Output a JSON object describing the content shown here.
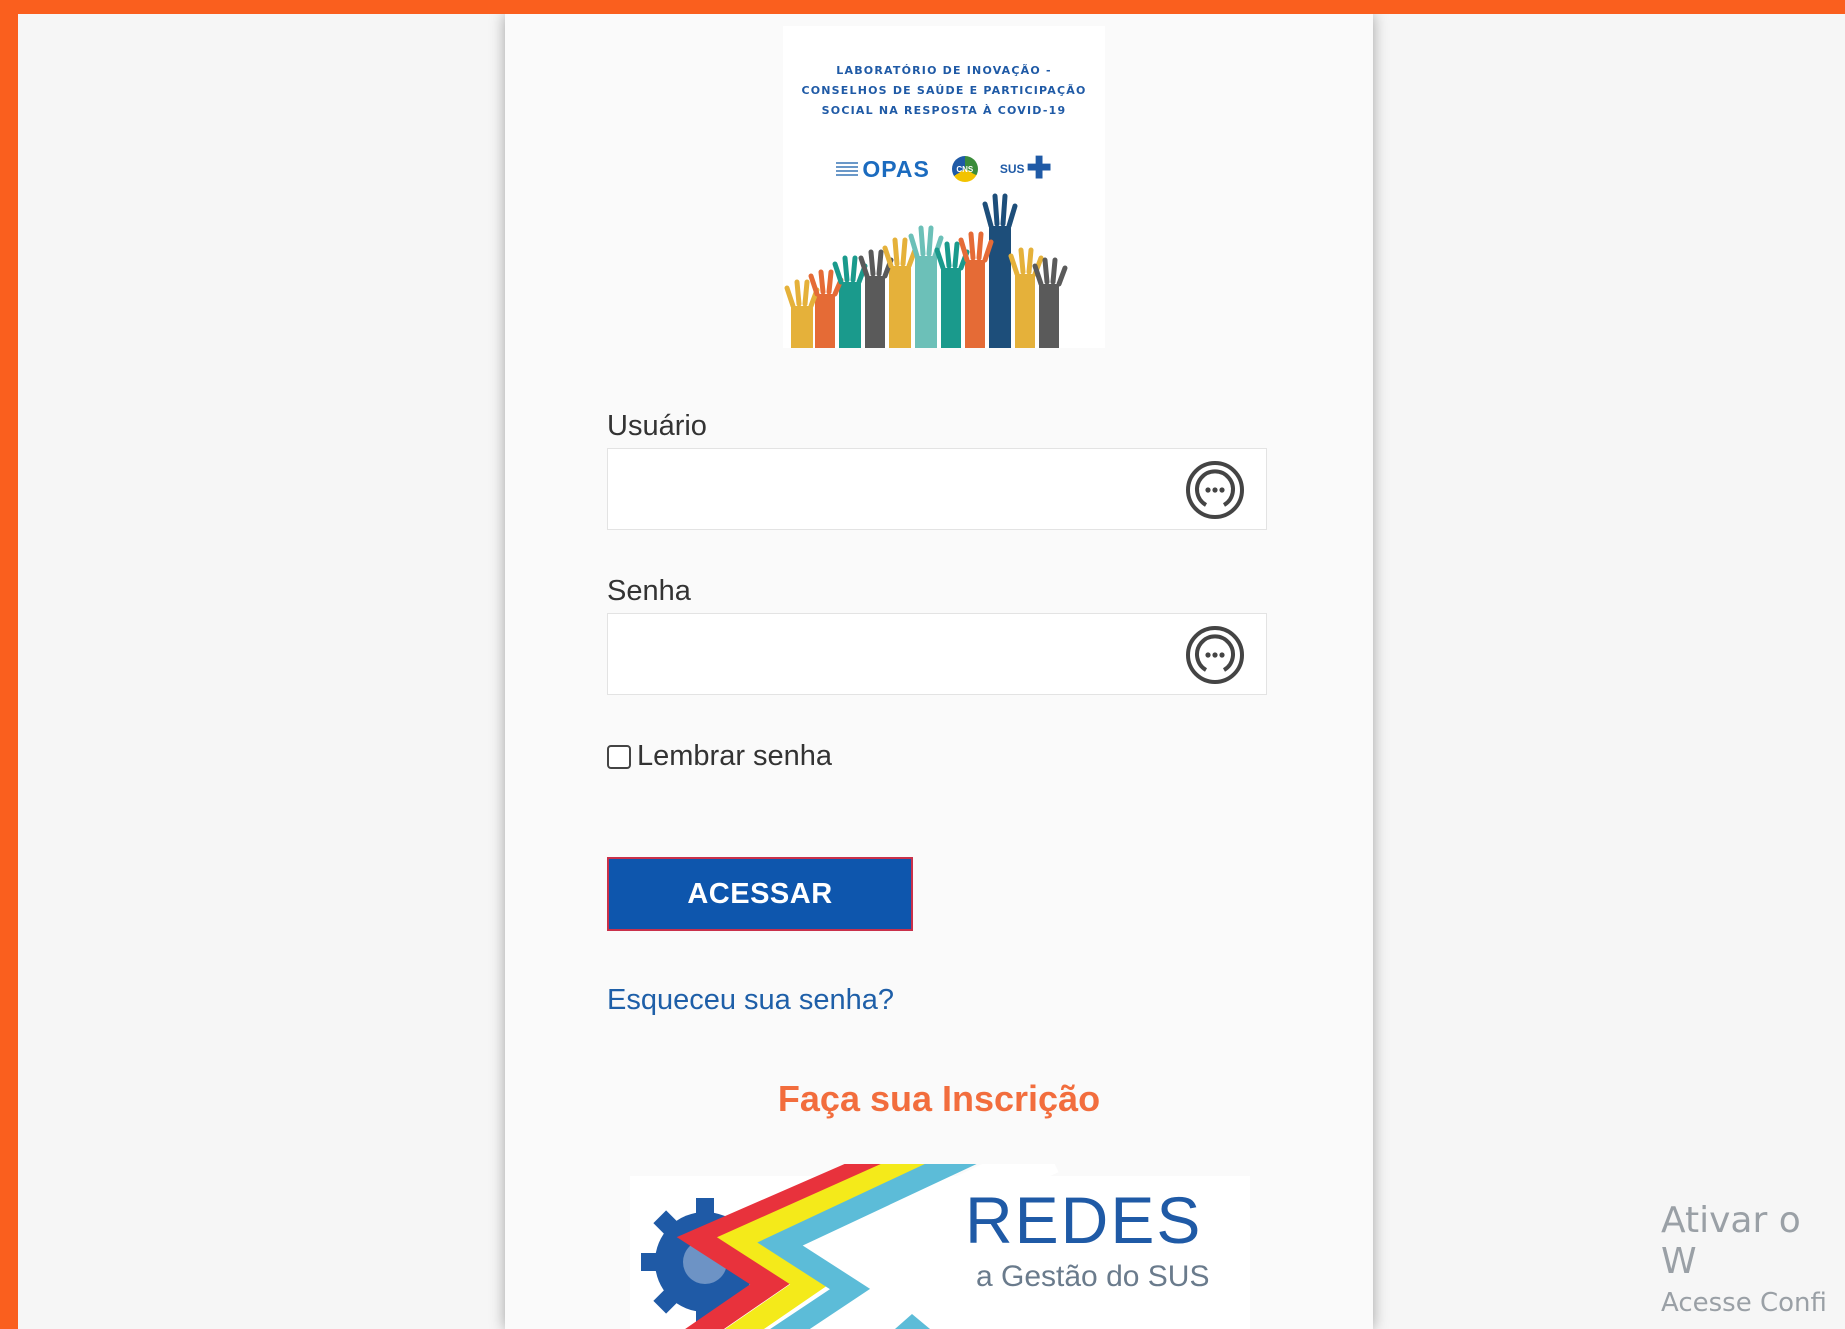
{
  "logo": {
    "title_lines": [
      "LABORATÓRIO DE INOVAÇÃO -",
      "CONSELHOS DE SAÚDE E PARTICIPAÇÃO",
      "SOCIAL NA RESPOSTA À COVID-19"
    ],
    "partners": [
      "OPAS",
      "CNS",
      "SUS"
    ]
  },
  "form": {
    "username_label": "Usuário",
    "username_value": "",
    "password_label": "Senha",
    "password_value": "",
    "remember_label": "Lembrar senha",
    "remember_checked": false,
    "submit_label": "ACESSAR",
    "forgot_link": "Esqueceu sua senha?"
  },
  "signup": {
    "heading": "Faça sua Inscrição",
    "banner_text": "REDES",
    "banner_subtext": "a Gestão do SUS"
  },
  "watermark": {
    "line1": "Ativar o W",
    "line2": "Acesse Confi"
  },
  "colors": {
    "frame": "#fa5f1e",
    "button": "#0e56ad",
    "link": "#1e5fa8",
    "signup_heading": "#f26d3d"
  }
}
